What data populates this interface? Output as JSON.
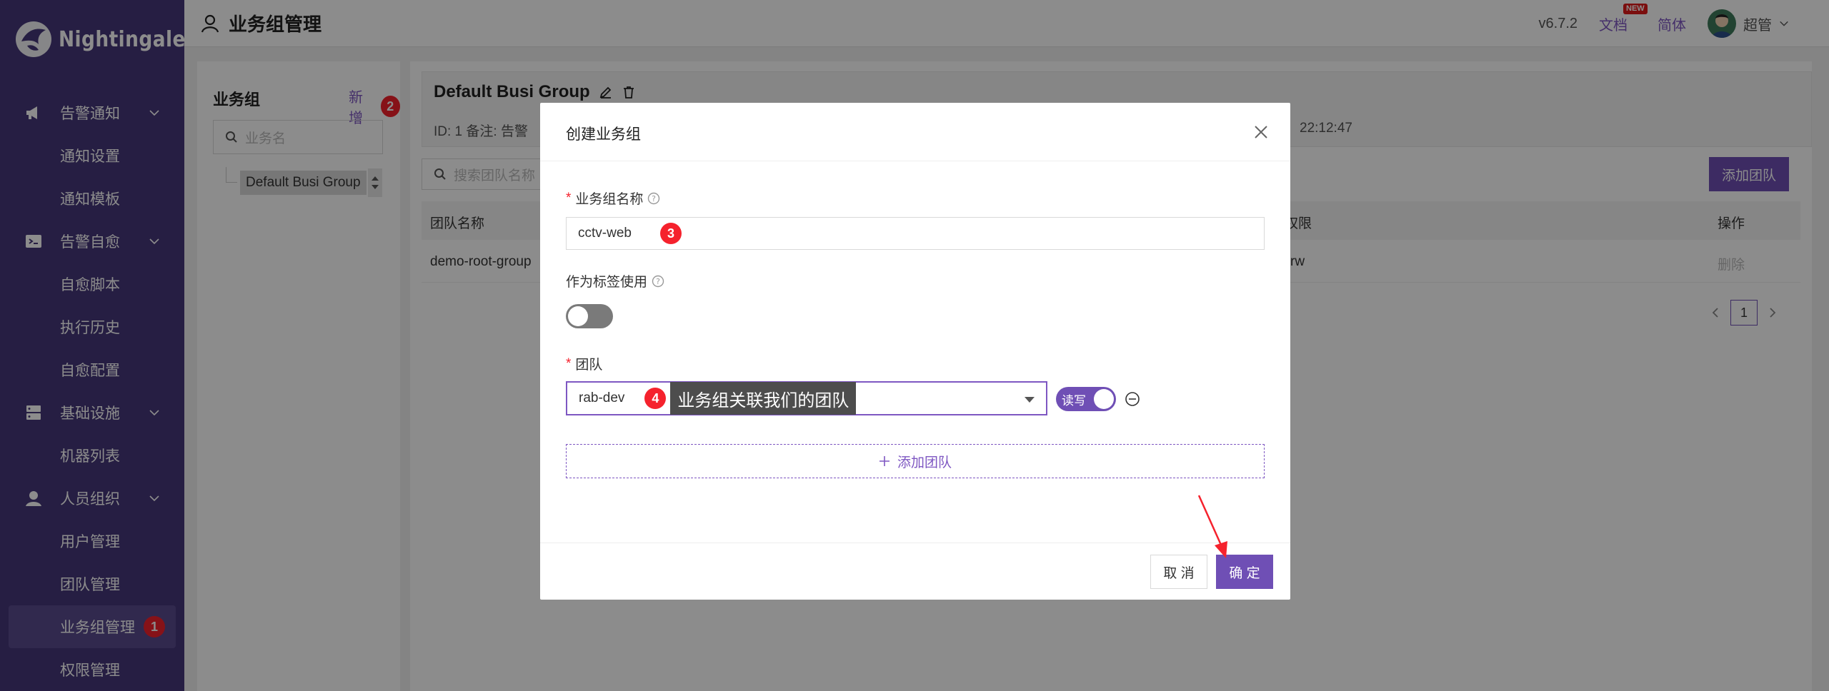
{
  "brand": {
    "name": "Nightingale"
  },
  "sidebar": {
    "groups": [
      {
        "label": "告警通知",
        "icon": "megaphone-icon",
        "items": [
          {
            "label": "通知设置"
          },
          {
            "label": "通知模板"
          }
        ]
      },
      {
        "label": "告警自愈",
        "icon": "terminal-icon",
        "items": [
          {
            "label": "自愈脚本"
          },
          {
            "label": "执行历史"
          },
          {
            "label": "自愈配置"
          }
        ]
      },
      {
        "label": "基础设施",
        "icon": "server-icon",
        "items": [
          {
            "label": "机器列表"
          }
        ]
      },
      {
        "label": "人员组织",
        "icon": "user-icon",
        "items": [
          {
            "label": "用户管理"
          },
          {
            "label": "团队管理"
          },
          {
            "label": "业务组管理",
            "active": true,
            "badge": "1"
          },
          {
            "label": "权限管理"
          }
        ]
      }
    ]
  },
  "header": {
    "title": "业务组管理",
    "version": "v6.7.2",
    "docs": "文档",
    "docs_badge": "NEW",
    "lang": "简体",
    "user": "超管"
  },
  "left_panel": {
    "title": "业务组",
    "add_label": "新增",
    "add_badge": "2",
    "search_placeholder": "业务名",
    "tree": [
      "Default Busi Group"
    ]
  },
  "main": {
    "group_name": "Default Busi Group",
    "meta": "ID:  1   备注: 告警",
    "time": "22:12:47",
    "team_search_placeholder": "搜索团队名称",
    "add_team_button": "添加团队",
    "table": {
      "columns": [
        "团队名称",
        "权限",
        "操作"
      ],
      "rows": [
        {
          "name": "demo-root-group",
          "perm": "rw",
          "action": "删除"
        }
      ]
    },
    "page": "1"
  },
  "modal": {
    "title": "创建业务组",
    "name_label": "业务组名称",
    "name_value": "cctv-web",
    "name_badge": "3",
    "tag_label": "作为标签使用",
    "tag_enabled": false,
    "team_label": "团队",
    "team_value": "rab-dev",
    "team_badge": "4",
    "tooltip": "业务组关联我们的团队",
    "perm_switch": "读写",
    "add_team": "添加团队",
    "cancel": "取 消",
    "ok": "确 定"
  },
  "colors": {
    "sidebar": "#46377a",
    "primary": "#6f4fb5",
    "badge": "#f5222d"
  }
}
